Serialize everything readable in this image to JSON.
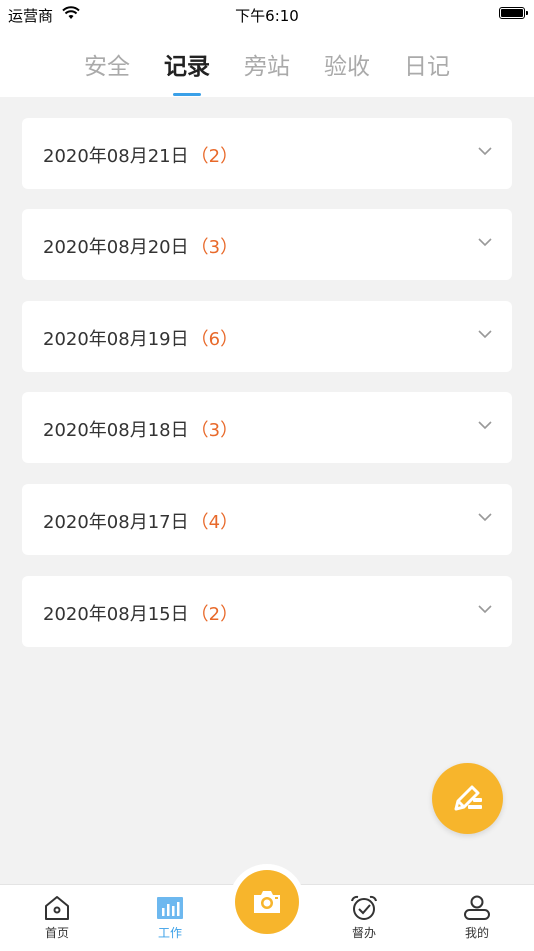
{
  "status_bar": {
    "carrier": "运营商",
    "time": "下午6:10"
  },
  "tabs": [
    {
      "label": "安全",
      "active": false
    },
    {
      "label": "记录",
      "active": true
    },
    {
      "label": "旁站",
      "active": false
    },
    {
      "label": "验收",
      "active": false
    },
    {
      "label": "日记",
      "active": false
    }
  ],
  "records": [
    {
      "date": "2020年08月21日",
      "count": "（2）"
    },
    {
      "date": "2020年08月20日",
      "count": "（3）"
    },
    {
      "date": "2020年08月19日",
      "count": "（6）"
    },
    {
      "date": "2020年08月18日",
      "count": "（3）"
    },
    {
      "date": "2020年08月17日",
      "count": "（4）"
    },
    {
      "date": "2020年08月15日",
      "count": "（2）"
    }
  ],
  "fab": {
    "icon": "edit-icon"
  },
  "tab_bar": {
    "items": [
      {
        "label": "首页",
        "icon": "home-icon"
      },
      {
        "label": "工作",
        "icon": "chart-icon",
        "active": true
      },
      {
        "label": "督办",
        "icon": "alarm-clock-icon"
      },
      {
        "label": "我的",
        "icon": "user-icon"
      }
    ],
    "center_icon": "camera-icon"
  },
  "colors": {
    "accent_blue": "#3aa0e8",
    "accent_orange": "#e8692a",
    "fab_yellow": "#f7b52c"
  }
}
